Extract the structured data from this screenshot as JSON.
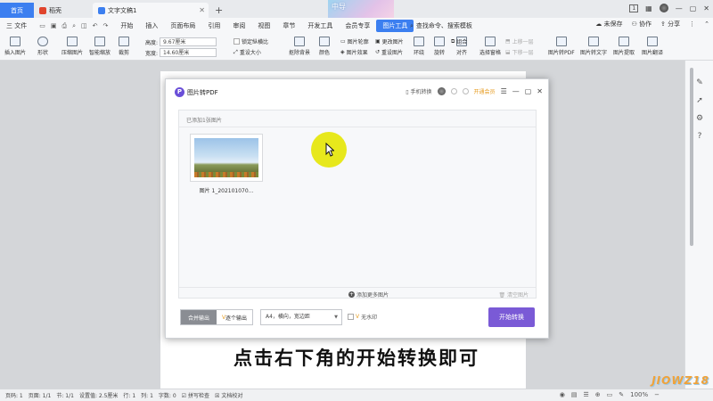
{
  "tabs": {
    "home": "首页",
    "docer": "稻壳",
    "doc": "文字文稿1",
    "add": "+"
  },
  "banner": "中导",
  "window": {
    "badge": "1"
  },
  "menu": {
    "file": "三 文件",
    "items": [
      "开始",
      "插入",
      "页面布局",
      "引用",
      "审阅",
      "视图",
      "章节",
      "开发工具",
      "会员专享",
      "图片工具"
    ],
    "search": "查找命令、搜索模板",
    "unsaved": "未保存",
    "collab": "协作",
    "share": "分享"
  },
  "ribbon": {
    "insert_pic": "插入图片",
    "shape": "形状",
    "compress": "压缩图片",
    "smart_zoom": "智能缩放",
    "crop": "裁剪",
    "height_label": "高度:",
    "height_value": "9.67厘米",
    "width_label": "宽度:",
    "width_value": "14.60厘米",
    "lock_ratio": "锁定纵横比",
    "reset_size": "重设大小",
    "remove_bg": "抠除背景",
    "color": "颜色",
    "outline": "图片轮廓",
    "effect": "图片效果",
    "change_pic": "更改图片",
    "reset_pic": "重设图片",
    "wrap": "环绕",
    "rotate": "旋转",
    "align": "对齐",
    "group": "组合",
    "select_pane": "选择窗格",
    "up_layer": "上移一层",
    "down_layer": "下移一层",
    "to_pdf": "图片转PDF",
    "to_text": "图片转文字",
    "extract": "图片提取",
    "translate": "图片翻译"
  },
  "dialog": {
    "logo": "P",
    "title": "图片转PDF",
    "phone": "手机转换",
    "vip": "开通会员",
    "panel_caption": "已添加1张图片",
    "file_name": "图片 1_202101070...",
    "add_more": "添加更多图片",
    "clear_all": "清空图片",
    "mode_merge": "合并输出",
    "mode_each": "逐个输出",
    "page_option": "A4，横向，宽边距",
    "no_watermark": "无水印",
    "start": "开始转换"
  },
  "subtitle": "点击右下角的开始转换即可",
  "status": {
    "page_num": "页码: 1",
    "pages": "页面: 1/1",
    "section": "节: 1/1",
    "setting": "设置值: 2.5厘米",
    "line": "行: 1",
    "col": "列: 1",
    "words": "字数: 0",
    "spell": "拼写检查",
    "proof": "文档校对",
    "zoom": "100%"
  },
  "logo_mark": "JIOWZ18"
}
